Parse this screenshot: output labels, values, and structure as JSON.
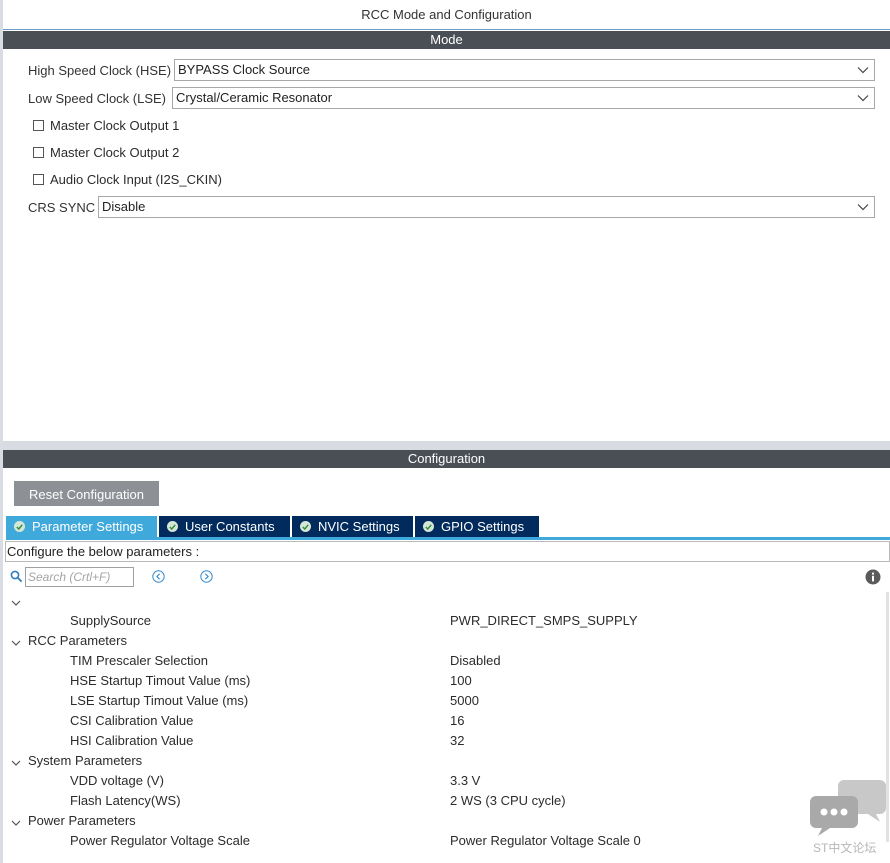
{
  "window": {
    "title": "RCC Mode and Configuration"
  },
  "mode_section": {
    "header": "Mode",
    "hse": {
      "label": "High Speed Clock (HSE)",
      "value": "BYPASS Clock Source"
    },
    "lse": {
      "label": "Low Speed Clock (LSE)",
      "value": "Crystal/Ceramic Resonator"
    },
    "checkboxes": [
      {
        "label": "Master Clock Output 1",
        "checked": false
      },
      {
        "label": "Master Clock Output 2",
        "checked": false
      },
      {
        "label": "Audio Clock Input (I2S_CKIN)",
        "checked": false
      }
    ],
    "crs_sync": {
      "label": "CRS SYNC",
      "value": "Disable"
    }
  },
  "configuration_section": {
    "header": "Configuration",
    "reset_button": "Reset Configuration",
    "tabs": [
      {
        "label": "Parameter Settings",
        "active": true
      },
      {
        "label": "User Constants",
        "active": false
      },
      {
        "label": "NVIC Settings",
        "active": false
      },
      {
        "label": "GPIO Settings",
        "active": false
      }
    ],
    "configure_text": "Configure the below parameters :",
    "search": {
      "placeholder": "Search (Crtl+F)"
    },
    "tree": [
      {
        "type": "group",
        "label": ""
      },
      {
        "type": "param",
        "name": "SupplySource",
        "value": "PWR_DIRECT_SMPS_SUPPLY"
      },
      {
        "type": "group",
        "label": "RCC Parameters"
      },
      {
        "type": "param",
        "name": "TIM Prescaler Selection",
        "value": "Disabled"
      },
      {
        "type": "param",
        "name": "HSE Startup Timout Value (ms)",
        "value": "100"
      },
      {
        "type": "param",
        "name": "LSE Startup Timout Value (ms)",
        "value": "5000"
      },
      {
        "type": "param",
        "name": "CSI Calibration Value",
        "value": "16"
      },
      {
        "type": "param",
        "name": "HSI Calibration Value",
        "value": "32"
      },
      {
        "type": "group",
        "label": "System Parameters"
      },
      {
        "type": "param",
        "name": "VDD voltage (V)",
        "value": "3.3 V"
      },
      {
        "type": "param",
        "name": "Flash Latency(WS)",
        "value": "2 WS (3 CPU cycle)"
      },
      {
        "type": "group",
        "label": "Power Parameters"
      },
      {
        "type": "param",
        "name": "Power Regulator Voltage Scale",
        "value": "Power Regulator Voltage Scale 0"
      }
    ]
  },
  "watermark": {
    "text": "ST中文论坛",
    "icon": "chat-bubbles-icon"
  },
  "colors": {
    "section_header_bg": "#4a4f55",
    "active_tab": "#3fa9dc",
    "inactive_tab": "#002b5c",
    "reset_button_bg": "#8d9196"
  }
}
